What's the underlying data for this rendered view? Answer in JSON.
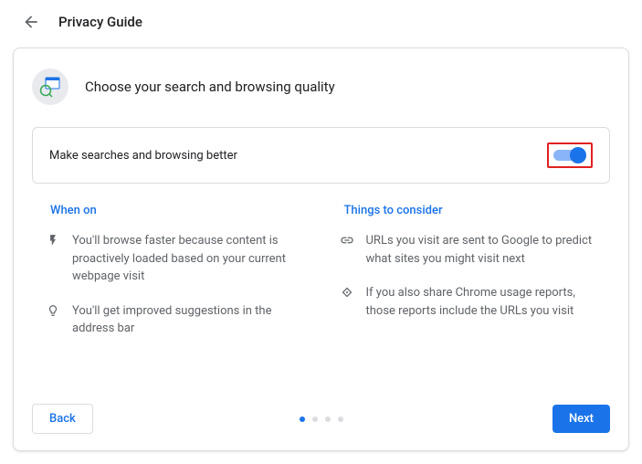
{
  "header": {
    "title": "Privacy Guide"
  },
  "card": {
    "title": "Choose your search and browsing quality",
    "toggle_label": "Make searches and browsing better",
    "toggle_on": true
  },
  "when_on": {
    "title": "When on",
    "items": [
      "You'll browse faster because content is proactively loaded based on your current webpage visit",
      "You'll get improved suggestions in the address bar"
    ]
  },
  "consider": {
    "title": "Things to consider",
    "items": [
      "URLs you visit are sent to Google to predict what sites you might visit next",
      "If you also share Chrome usage reports, those reports include the URLs you visit"
    ]
  },
  "footer": {
    "back": "Back",
    "next": "Next"
  },
  "pagination": {
    "total": 4,
    "active": 0
  }
}
